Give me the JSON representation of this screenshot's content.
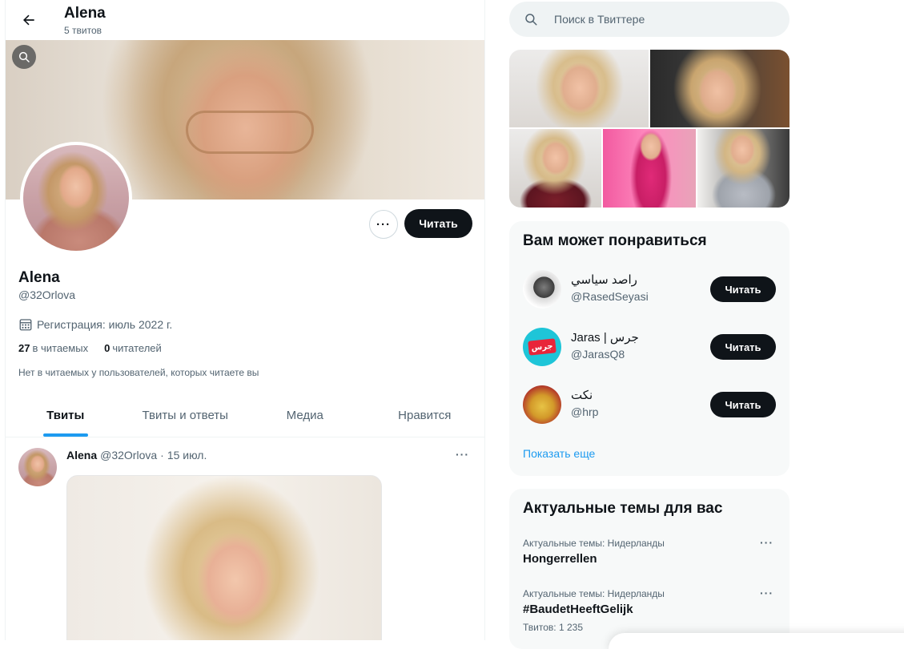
{
  "header": {
    "name": "Alena",
    "tweet_count": "5 твитов"
  },
  "profile": {
    "name": "Alena",
    "handle": "@32Orlova",
    "joined": "Регистрация: июль 2022 г.",
    "following_count": "27",
    "following_label": "в читаемых",
    "followers_count": "0",
    "followers_label": "читателей",
    "mutuals_note": "Нет в читаемых у пользователей, которых читаете вы",
    "follow_label": "Читать",
    "more_label": "···"
  },
  "tabs": [
    {
      "label": "Твиты",
      "active": true
    },
    {
      "label": "Твиты и ответы",
      "active": false
    },
    {
      "label": "Медиа",
      "active": false
    },
    {
      "label": "Нравится",
      "active": false
    }
  ],
  "tweet": {
    "name": "Alena",
    "handle": "@32Orlova",
    "sep": "·",
    "date": "15 июл.",
    "more_label": "···"
  },
  "search": {
    "placeholder": "Поиск в Твиттере"
  },
  "who_to_follow": {
    "title": "Вам может понравиться",
    "items": [
      {
        "name": "راصد سياسي",
        "handle": "@RasedSeyasi",
        "button": "Читать"
      },
      {
        "name": "Jaras | جرس",
        "handle": "@JarasQ8",
        "button": "Читать"
      },
      {
        "name": "نكت",
        "handle": "@hrp",
        "button": "Читать"
      }
    ],
    "show_more": "Показать еще",
    "jaras_logo_text": "جرس"
  },
  "trends": {
    "title": "Актуальные темы для вас",
    "items": [
      {
        "meta": "Актуальные темы: Нидерланды",
        "name": "Hongerrellen",
        "count": "",
        "more": "···"
      },
      {
        "meta": "Актуальные темы: Нидерланды",
        "name": "#BaudetHeeftGelijk",
        "count": "Твитов: 1 235",
        "more": "···"
      }
    ]
  },
  "colors": {
    "accent": "#1d9bf0",
    "text_primary": "#0f1419",
    "text_secondary": "#536471",
    "button_dark": "#0f1419",
    "panel_bg": "#f7f9f9"
  },
  "icons": [
    "back-arrow-icon",
    "search-icon",
    "calendar-icon",
    "more-icon"
  ]
}
